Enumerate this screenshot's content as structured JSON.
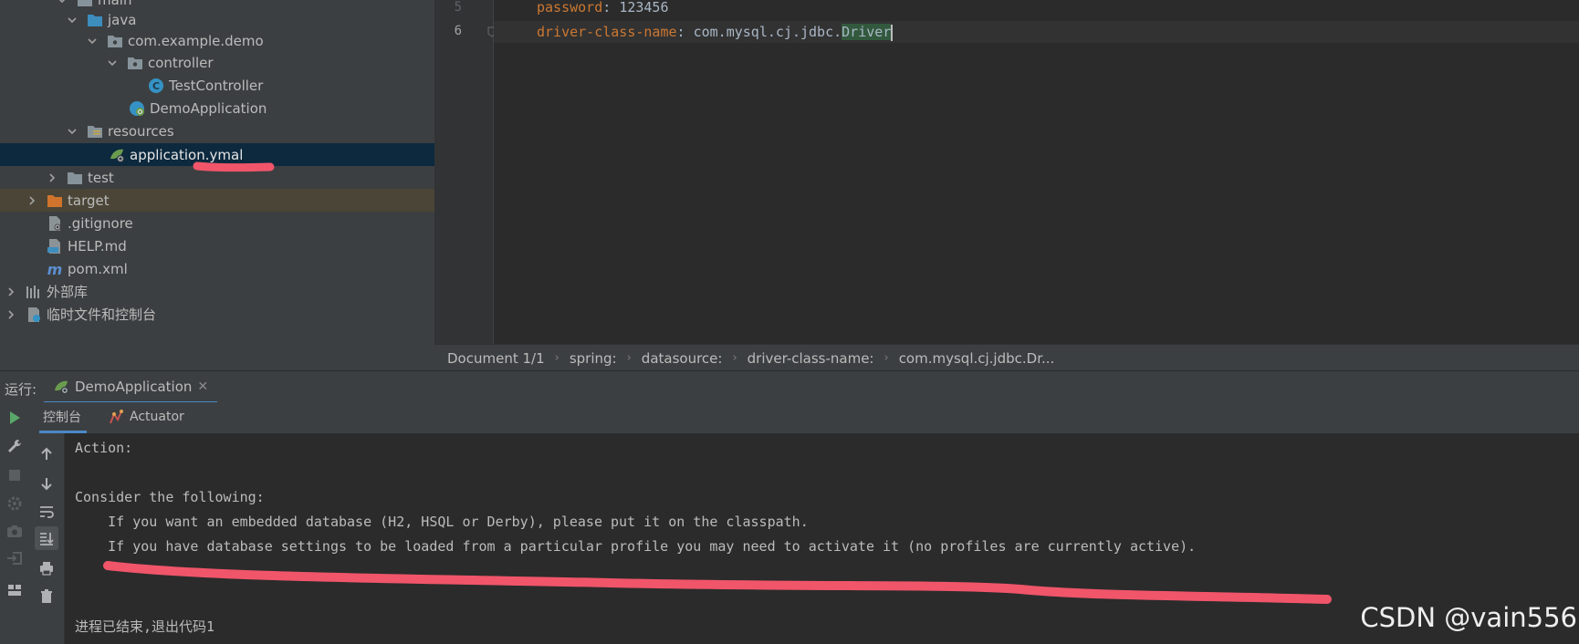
{
  "tree": {
    "items": [
      {
        "label": "main",
        "depth": 2,
        "icon": "folder-icon"
      },
      {
        "label": "java",
        "depth": 3,
        "icon": "source-folder-icon"
      },
      {
        "label": "com.example.demo",
        "depth": 4,
        "icon": "package-icon"
      },
      {
        "label": "controller",
        "depth": 5,
        "icon": "package-icon"
      },
      {
        "label": "TestController",
        "depth": 6,
        "icon": "class-icon"
      },
      {
        "label": "DemoApplication",
        "depth": 5,
        "icon": "spring-boot-class-icon"
      },
      {
        "label": "resources",
        "depth": 3,
        "icon": "resources-folder-icon"
      },
      {
        "label": "application.ymal",
        "depth": 4,
        "icon": "spring-config-file-icon"
      },
      {
        "label": "test",
        "depth": 2,
        "icon": "folder-icon"
      },
      {
        "label": "target",
        "depth": 1,
        "icon": "excluded-folder-icon"
      },
      {
        "label": ".gitignore",
        "depth": 1,
        "icon": "gitignore-file-icon"
      },
      {
        "label": "HELP.md",
        "depth": 1,
        "icon": "markdown-file-icon"
      },
      {
        "label": "pom.xml",
        "depth": 1,
        "icon": "maven-file-icon"
      },
      {
        "label": "外部库",
        "depth": 0,
        "icon": "library-icon"
      },
      {
        "label": "临时文件和控制台",
        "depth": 0,
        "icon": "scratch-icon"
      }
    ]
  },
  "editor": {
    "lines": [
      {
        "number": "5",
        "key": "password",
        "value": "123456"
      },
      {
        "number": "6",
        "key": "driver-class-name",
        "value_prefix": "com.mysql.cj.jdbc.",
        "value_highlight": "Driver"
      }
    ],
    "breadcrumb": [
      "Document 1/1",
      "spring:",
      "datasource:",
      "driver-class-name:",
      "com.mysql.cj.jdbc.Dr..."
    ]
  },
  "run": {
    "label": "运行:",
    "tab": "DemoApplication",
    "subtabs": [
      "控制台",
      "Actuator"
    ],
    "console": [
      "Action:",
      "",
      "Consider the following:",
      "    If you want an embedded database (H2, HSQL or Derby), please put it on the classpath.",
      "    If you have database settings to be loaded from a particular profile you may need to activate it (no profiles are currently active).",
      "",
      "",
      "进程已结束,退出代码1"
    ]
  },
  "watermark": "CSDN @vain556",
  "colors": {
    "accent": "#4a88c7",
    "annotation_red": "#f0556a",
    "yaml_key": "#cc7832",
    "selection": "#0d293e"
  }
}
